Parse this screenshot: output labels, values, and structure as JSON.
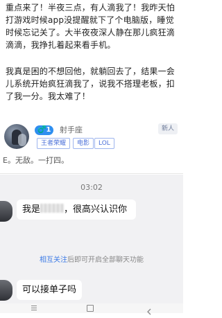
{
  "post": {
    "paragraph_1": "重点来了！半夜三点，有人滴我了！我昨天怕打游戏时候app没提醒就下了个电脑版，睡觉时候忘记关了。大半夜夜深人静在那儿疯狂滴滴滴，我挣扎着起来看手机。",
    "paragraph_2": "我真是困的不想回他，就躺回去了，结果一会儿系统开始疯狂滴我了，说我不搭理老板，扣了我一分。我太难了！"
  },
  "profile": {
    "level_badge": "♂️1",
    "zodiac": "射手座",
    "new_badge": "新人",
    "tags": [
      "王者荣耀",
      "电影",
      "LOL"
    ],
    "bio": "E。无敌。一打四。"
  },
  "chat": {
    "timestamp": "03:02",
    "message_1_prefix": "我是",
    "message_1_suffix": "，很高兴认识你",
    "notice_link": "相互关注",
    "notice_rest": "后即可开启全部聊天功能",
    "message_2": "可以接单子吗"
  },
  "colors": {
    "accent_blue": "#2f8ff0",
    "link_blue": "#3d7be6",
    "chat_bg": "#f1f1f3"
  }
}
